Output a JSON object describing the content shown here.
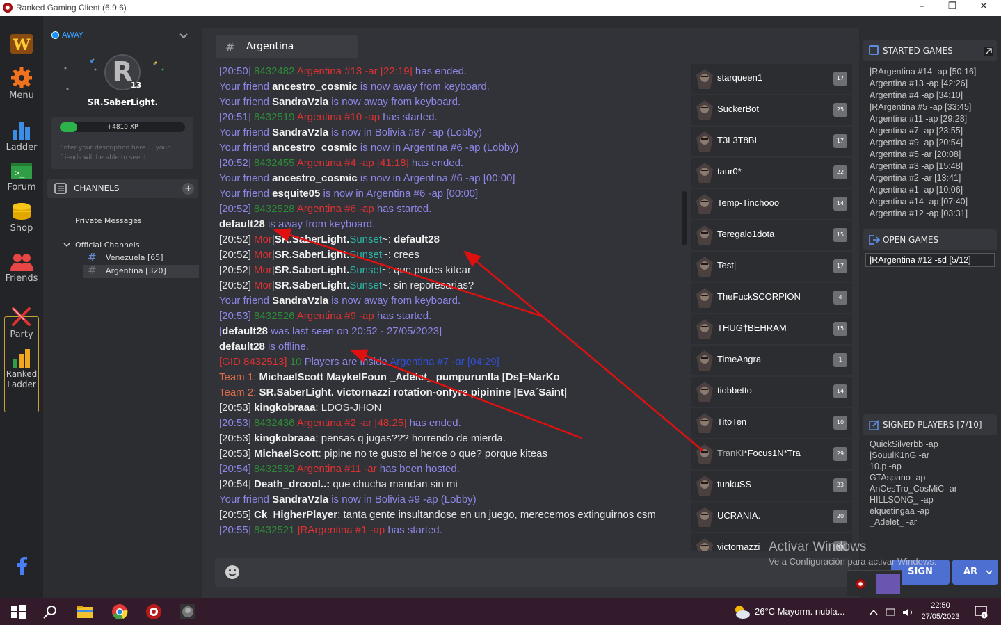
{
  "window": {
    "title": "Ranked Gaming Client (6.9.6)"
  },
  "nav": {
    "menu": "Menu",
    "ladder": "Ladder",
    "forum": "Forum",
    "shop": "Shop",
    "friends": "Friends",
    "party": "Party",
    "ranked_ladder_1": "Ranked",
    "ranked_ladder_2": "Ladder"
  },
  "profile": {
    "status": "AWAY",
    "level": "13",
    "username": "SR.SaberLight.",
    "xp_label": "+4810 XP",
    "xp_progress": 0.14,
    "description_placeholder": "Enter your description here ... your friends will be able to see it"
  },
  "channels": {
    "header": "CHANNELS",
    "private_messages": "Private Messages",
    "official": "Official Channels",
    "items": [
      {
        "label": "Venezuela [65]"
      },
      {
        "label": "Argentina [320]"
      }
    ]
  },
  "chat": {
    "channel_name": "Argentina",
    "lines": [
      [
        {
          "c": "p",
          "t": "[20:50] "
        },
        {
          "c": "g",
          "t": "8432482 "
        },
        {
          "c": "r",
          "t": "Argentina #13 -ar [22:19] "
        },
        {
          "c": "p",
          "t": "has ended."
        }
      ],
      [
        {
          "c": "p",
          "t": "Your friend "
        },
        {
          "c": "b",
          "t": "ancestro_cosmic"
        },
        {
          "c": "p",
          "t": " is now away from keyboard."
        }
      ],
      [
        {
          "c": "p",
          "t": "Your friend "
        },
        {
          "c": "b",
          "t": "SandraVzla"
        },
        {
          "c": "p",
          "t": " is now away from keyboard."
        }
      ],
      [
        {
          "c": "p",
          "t": "[20:51] "
        },
        {
          "c": "g",
          "t": "8432519 "
        },
        {
          "c": "r",
          "t": "Argentina #10 -ap "
        },
        {
          "c": "p",
          "t": "has started."
        }
      ],
      [
        {
          "c": "p",
          "t": "Your friend "
        },
        {
          "c": "b",
          "t": "SandraVzla"
        },
        {
          "c": "p",
          "t": " is now in Bolivia #87 -ap (Lobby)"
        }
      ],
      [
        {
          "c": "p",
          "t": "Your friend "
        },
        {
          "c": "b",
          "t": "ancestro_cosmic"
        },
        {
          "c": "p",
          "t": " is now in Argentina #6 -ap (Lobby)"
        }
      ],
      [
        {
          "c": "p",
          "t": "[20:52] "
        },
        {
          "c": "g",
          "t": "8432455 "
        },
        {
          "c": "r",
          "t": "Argentina #4 -ap [41:18] "
        },
        {
          "c": "p",
          "t": "has ended."
        }
      ],
      [
        {
          "c": "p",
          "t": "Your friend "
        },
        {
          "c": "b",
          "t": "ancestro_cosmic"
        },
        {
          "c": "p",
          "t": " is now in Argentina #6 -ap [00:00]"
        }
      ],
      [
        {
          "c": "p",
          "t": "Your friend "
        },
        {
          "c": "b",
          "t": "esquite05"
        },
        {
          "c": "p",
          "t": " is now in Argentina #6 -ap [00:00]"
        }
      ],
      [
        {
          "c": "p",
          "t": "[20:52] "
        },
        {
          "c": "g",
          "t": "8432528 "
        },
        {
          "c": "r",
          "t": "Argentina #6 -ap "
        },
        {
          "c": "p",
          "t": "has started."
        }
      ],
      [
        {
          "c": "b",
          "t": "default28"
        },
        {
          "c": "p",
          "t": " is away from keyboard."
        }
      ],
      [
        {
          "c": "w",
          "t": "[20:52] "
        },
        {
          "c": "r",
          "t": "Mor"
        },
        {
          "c": "gr",
          "t": "|"
        },
        {
          "c": "b",
          "t": "SR.SaberLight."
        },
        {
          "c": "t",
          "t": "Sunset"
        },
        {
          "c": "w",
          "t": "~: "
        },
        {
          "c": "b",
          "t": "default28"
        }
      ],
      [
        {
          "c": "w",
          "t": "[20:52] "
        },
        {
          "c": "r",
          "t": "Mor"
        },
        {
          "c": "gr",
          "t": "|"
        },
        {
          "c": "b",
          "t": "SR.SaberLight."
        },
        {
          "c": "t",
          "t": "Sunset"
        },
        {
          "c": "w",
          "t": "~: crees"
        }
      ],
      [
        {
          "c": "w",
          "t": "[20:52] "
        },
        {
          "c": "r",
          "t": "Mor"
        },
        {
          "c": "gr",
          "t": "|"
        },
        {
          "c": "b",
          "t": "SR.SaberLight."
        },
        {
          "c": "t",
          "t": "Sunset"
        },
        {
          "c": "w",
          "t": "~: que podes kitear"
        }
      ],
      [
        {
          "c": "w",
          "t": "[20:52] "
        },
        {
          "c": "r",
          "t": "Mor"
        },
        {
          "c": "gr",
          "t": "|"
        },
        {
          "c": "b",
          "t": "SR.SaberLight."
        },
        {
          "c": "t",
          "t": "Sunset"
        },
        {
          "c": "w",
          "t": "~: sin reporesarias?"
        }
      ],
      [
        {
          "c": "p",
          "t": "Your friend "
        },
        {
          "c": "b",
          "t": "SandraVzla"
        },
        {
          "c": "p",
          "t": " is now away from keyboard."
        }
      ],
      [
        {
          "c": "p",
          "t": "[20:53] "
        },
        {
          "c": "g",
          "t": "8432526 "
        },
        {
          "c": "r",
          "t": "Argentina #9 -ap "
        },
        {
          "c": "p",
          "t": "has started."
        }
      ],
      [
        {
          "c": "p",
          "t": "["
        },
        {
          "c": "b",
          "t": "default28"
        },
        {
          "c": "p",
          "t": " was last seen on 20:52 - 27/05/2023]"
        }
      ],
      [
        {
          "c": "b",
          "t": "default28"
        },
        {
          "c": "p",
          "t": " is offline."
        }
      ],
      [
        {
          "c": "r",
          "t": "[GID 8432513] "
        },
        {
          "c": "g",
          "t": "10 "
        },
        {
          "c": "p",
          "t": "Players are inside "
        },
        {
          "c": "blue",
          "t": "Argentina #7 -ar [04:29]"
        }
      ],
      [
        {
          "c": "o",
          "t": "Team 1:   "
        },
        {
          "c": "b",
          "t": "MichaelScott   MaykelFoun   _Adelet_   pumpurunlla   [Ds]=NarKo"
        }
      ],
      [
        {
          "c": "o",
          "t": "Team 2:   "
        },
        {
          "c": "b",
          "t": "SR.SaberLight.   victornazzi   rotation-onfyre   pipinine   |Eva´Saint|"
        }
      ],
      [
        {
          "c": "w",
          "t": "[20:53] "
        },
        {
          "c": "b",
          "t": "kingkobraaa"
        },
        {
          "c": "w",
          "t": ": LDOS-JHON"
        }
      ],
      [
        {
          "c": "p",
          "t": "[20:53] "
        },
        {
          "c": "g",
          "t": "8432436 "
        },
        {
          "c": "r",
          "t": "Argentina #2 -ar [48:25] "
        },
        {
          "c": "p",
          "t": "has ended."
        }
      ],
      [
        {
          "c": "w",
          "t": "[20:53] "
        },
        {
          "c": "b",
          "t": "kingkobraaa"
        },
        {
          "c": "w",
          "t": ": pensas q jugas??? horrendo de mierda."
        }
      ],
      [
        {
          "c": "w",
          "t": "[20:53] "
        },
        {
          "c": "b",
          "t": "MichaelScott"
        },
        {
          "c": "w",
          "t": ": pipine no te gusto el heroe o que? porque kiteas"
        }
      ],
      [
        {
          "c": "p",
          "t": "[20:54] "
        },
        {
          "c": "g",
          "t": "8432532 "
        },
        {
          "c": "r",
          "t": "Argentina #11 -ar "
        },
        {
          "c": "p",
          "t": "has been hosted."
        }
      ],
      [
        {
          "c": "w",
          "t": "[20:54] "
        },
        {
          "c": "b",
          "t": "Death_drcool..:"
        },
        {
          "c": "w",
          "t": " que chucha mandan sin mi"
        }
      ],
      [
        {
          "c": "p",
          "t": "Your friend "
        },
        {
          "c": "b",
          "t": "SandraVzla"
        },
        {
          "c": "p",
          "t": " is now in Bolivia #9 -ap (Lobby)"
        }
      ],
      [
        {
          "c": "w",
          "t": "[20:55] "
        },
        {
          "c": "b",
          "t": "Ck_HigherPlayer"
        },
        {
          "c": "w",
          "t": ": tanta gente insultandose en un juego, merecemos extinguirnos csm"
        }
      ],
      [
        {
          "c": "p",
          "t": "[20:55] "
        },
        {
          "c": "g",
          "t": "8432521 "
        },
        {
          "c": "r",
          "t": "|RArgentina #1 -ap "
        },
        {
          "c": "p",
          "t": "has started."
        }
      ]
    ]
  },
  "members": [
    {
      "name": "starqueen1",
      "level": "17"
    },
    {
      "name": "SuckerBot",
      "level": "25"
    },
    {
      "name": "T3L3T8BI",
      "level": "17"
    },
    {
      "name": "taur0*",
      "level": "22"
    },
    {
      "name": "Temp-Tinchooo",
      "level": "14"
    },
    {
      "name": "Teregalo1dota",
      "level": "15"
    },
    {
      "name": "Test|",
      "level": "17"
    },
    {
      "name": "TheFuckSCORPION",
      "level": "4"
    },
    {
      "name": "THUG†BEHRAM",
      "level": "15"
    },
    {
      "name": "TimeAngra",
      "level": "1"
    },
    {
      "name": "tiobbetto",
      "level": "14"
    },
    {
      "name": "TitoTen",
      "level": "10"
    },
    {
      "name": "TranKI*Focus1N*Tra",
      "level": "29"
    },
    {
      "name": "tunkuSS",
      "level": "23"
    },
    {
      "name": "UCRANIA.",
      "level": "20"
    },
    {
      "name": "victornazzi",
      "level": "33"
    }
  ],
  "started_games": {
    "header": "STARTED GAMES",
    "items": [
      "|RArgentina #14 -ap [50:16]",
      "Argentina #13 -ap [42:26]",
      "Argentina #4 -ap [34:10]",
      "|RArgentina #5 -ap [33:45]",
      "Argentina #11 -ap [29:28]",
      "Argentina #7 -ap [23:55]",
      "Argentina #9 -ap [20:54]",
      "Argentina #5 -ar [20:08]",
      "Argentina #3 -ap [15:48]",
      "Argentina #2 -ar [13:41]",
      "Argentina #1 -ap [10:06]",
      "Argentina #14 -ap [07:40]",
      "Argentina #12 -ap [03:31]"
    ]
  },
  "open_games": {
    "header": "OPEN GAMES",
    "items": [
      "|RArgentina #12 -sd [5/12]"
    ]
  },
  "signed_players": {
    "header": "SIGNED PLAYERS [7/10]",
    "items": [
      "QuickSilverbb -ap",
      "|SouulK1nG -ar",
      "10.p -ap",
      "GTAspano -ap",
      "AnCesTro_CosMiC -ar",
      "HILLSONG_ -ap",
      "elquetingaa -ap",
      "_Adelet_ -ar"
    ]
  },
  "buttons": {
    "sign": "SIGN",
    "region": "AR"
  },
  "watermark": {
    "line1": "Activar Windows",
    "line2": "Ve a Configuración para activar Windows."
  },
  "taskbar": {
    "weather": "26°C  Mayorm. nubla...",
    "time": "22:50",
    "date": "27/05/2023"
  }
}
